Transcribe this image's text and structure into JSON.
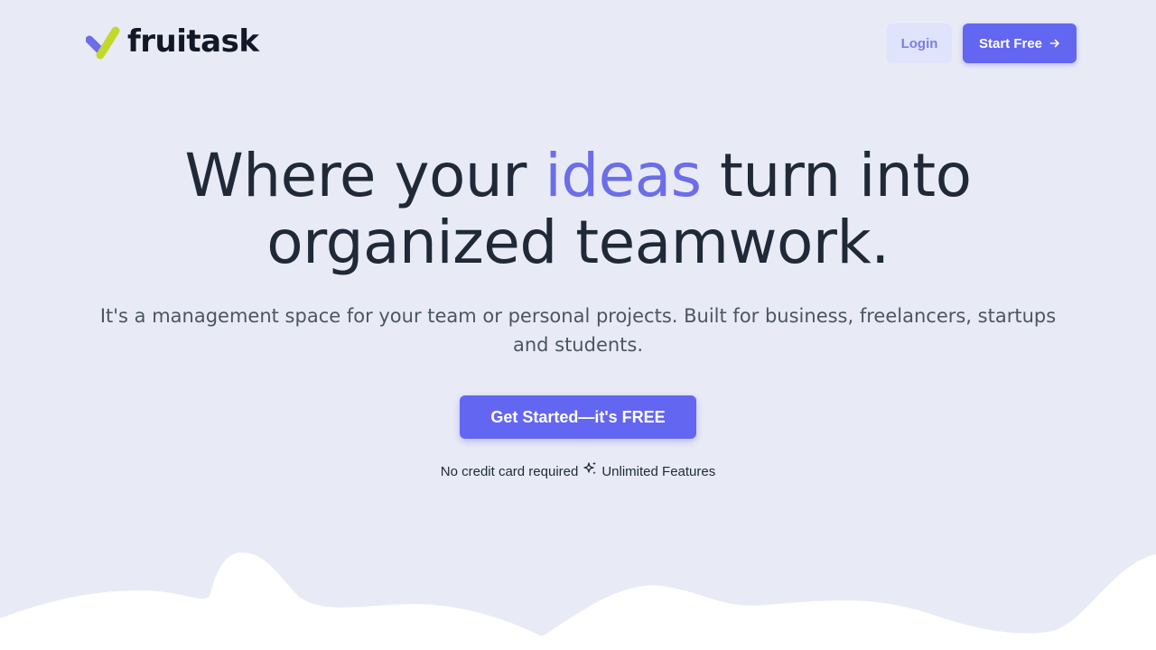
{
  "brand": {
    "name": "fruitask",
    "colors": {
      "check_purple": "#6b6ee8",
      "check_green": "#c3d82c",
      "primary": "#6366f1"
    }
  },
  "header": {
    "login_label": "Login",
    "start_label": "Start Free",
    "start_icon": "arrow-right-icon"
  },
  "hero": {
    "title_part1": "Where your ",
    "title_accent": "ideas",
    "title_part2": " turn into",
    "title_line2": "organized teamwork.",
    "subtitle": "It's a management space for your team or personal projects. Built for business, freelancers, startups and students.",
    "cta_label": "Get Started—it's FREE",
    "note_left": "No credit card required",
    "note_icon": "sparkle-icon",
    "note_right": "Unlimited Features"
  },
  "colors": {
    "background": "#e8ebf5",
    "wave": "#ffffff",
    "heading": "#1f2937",
    "accent_text": "#6b6ee8"
  }
}
